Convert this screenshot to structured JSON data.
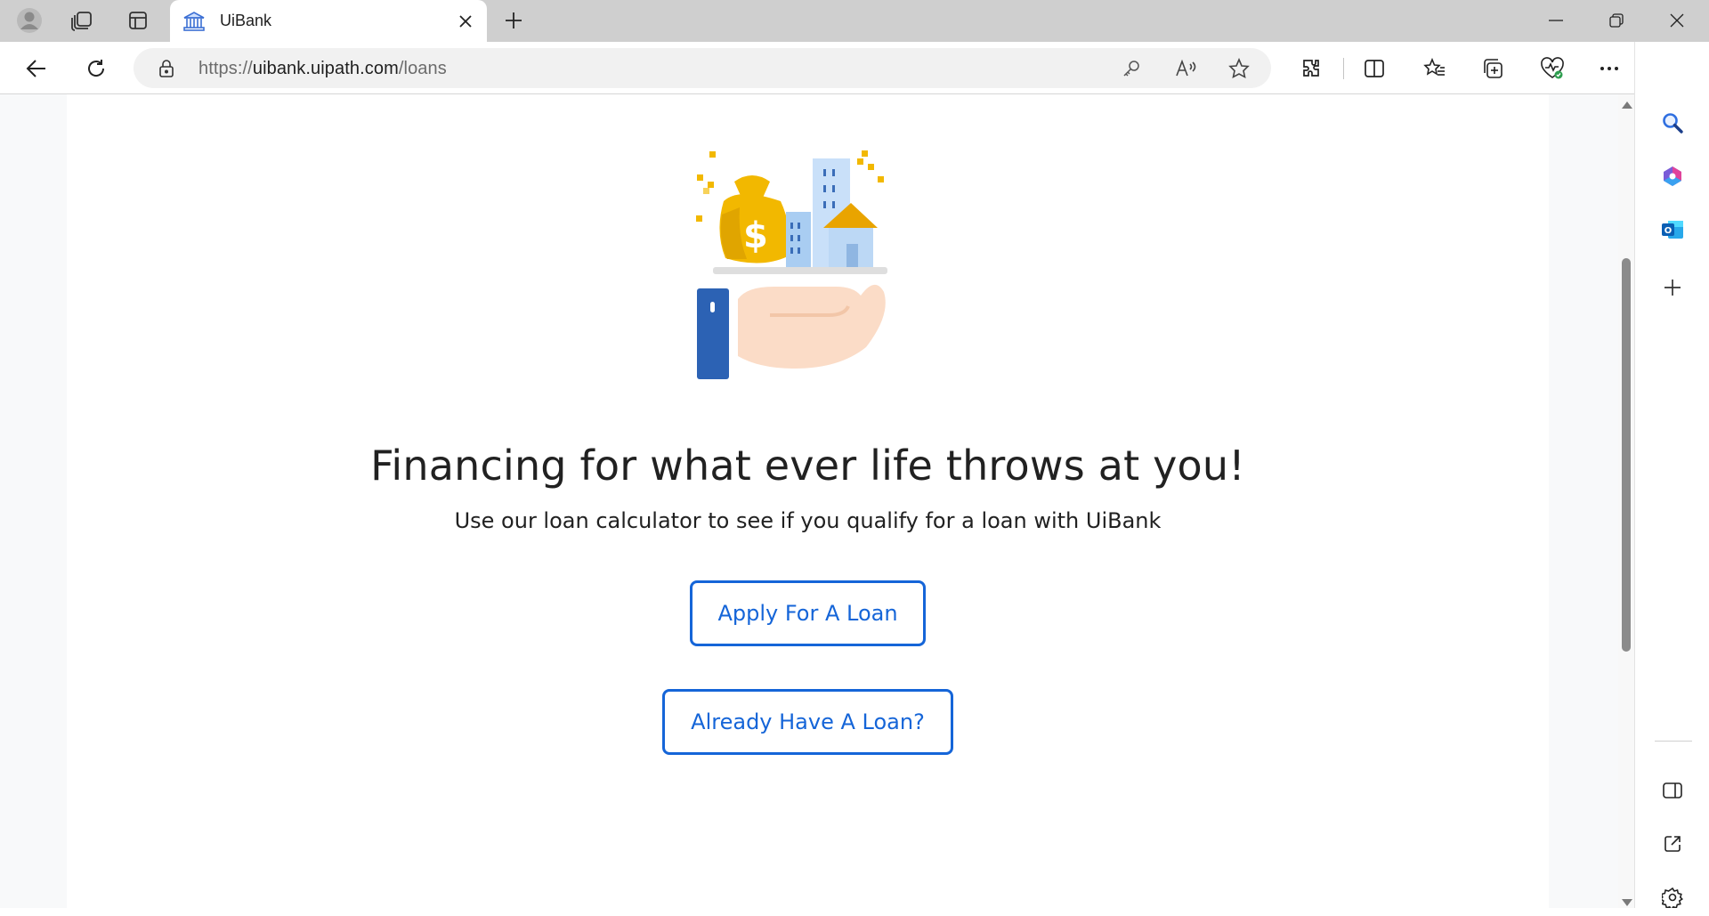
{
  "browser": {
    "tab": {
      "title": "UiBank",
      "favicon": "bank-icon"
    },
    "address_bar": {
      "url_prefix": "https://",
      "url_host": "uibank.uipath.com",
      "url_path": "/loans"
    },
    "toolbar_icons": [
      "back-icon",
      "refresh-icon",
      "lock-icon",
      "key-icon",
      "read-aloud-icon",
      "favorite-star-icon",
      "extensions-icon",
      "split-screen-icon",
      "favorites-icon",
      "collections-icon",
      "browser-essentials-icon",
      "more-icon",
      "bing-copilot-icon"
    ],
    "sidebar_icons": [
      "search-icon",
      "microsoft365-icon",
      "outlook-icon",
      "add-icon",
      "hide-sidebar-icon",
      "open-external-icon",
      "settings-icon"
    ]
  },
  "page": {
    "hero_image": "loan-hand-money-bag-buildings-illustration",
    "headline": "Financing for what ever life throws at you!",
    "subline": "Use our loan calculator to see if you qualify for a loan with UiBank",
    "buttons": {
      "apply": "Apply For A Loan",
      "existing": "Already Have A Loan?"
    }
  },
  "colors": {
    "accent": "#1565d8",
    "tabstrip": "#cfcfcf",
    "page_bg": "#f8f9fa"
  }
}
